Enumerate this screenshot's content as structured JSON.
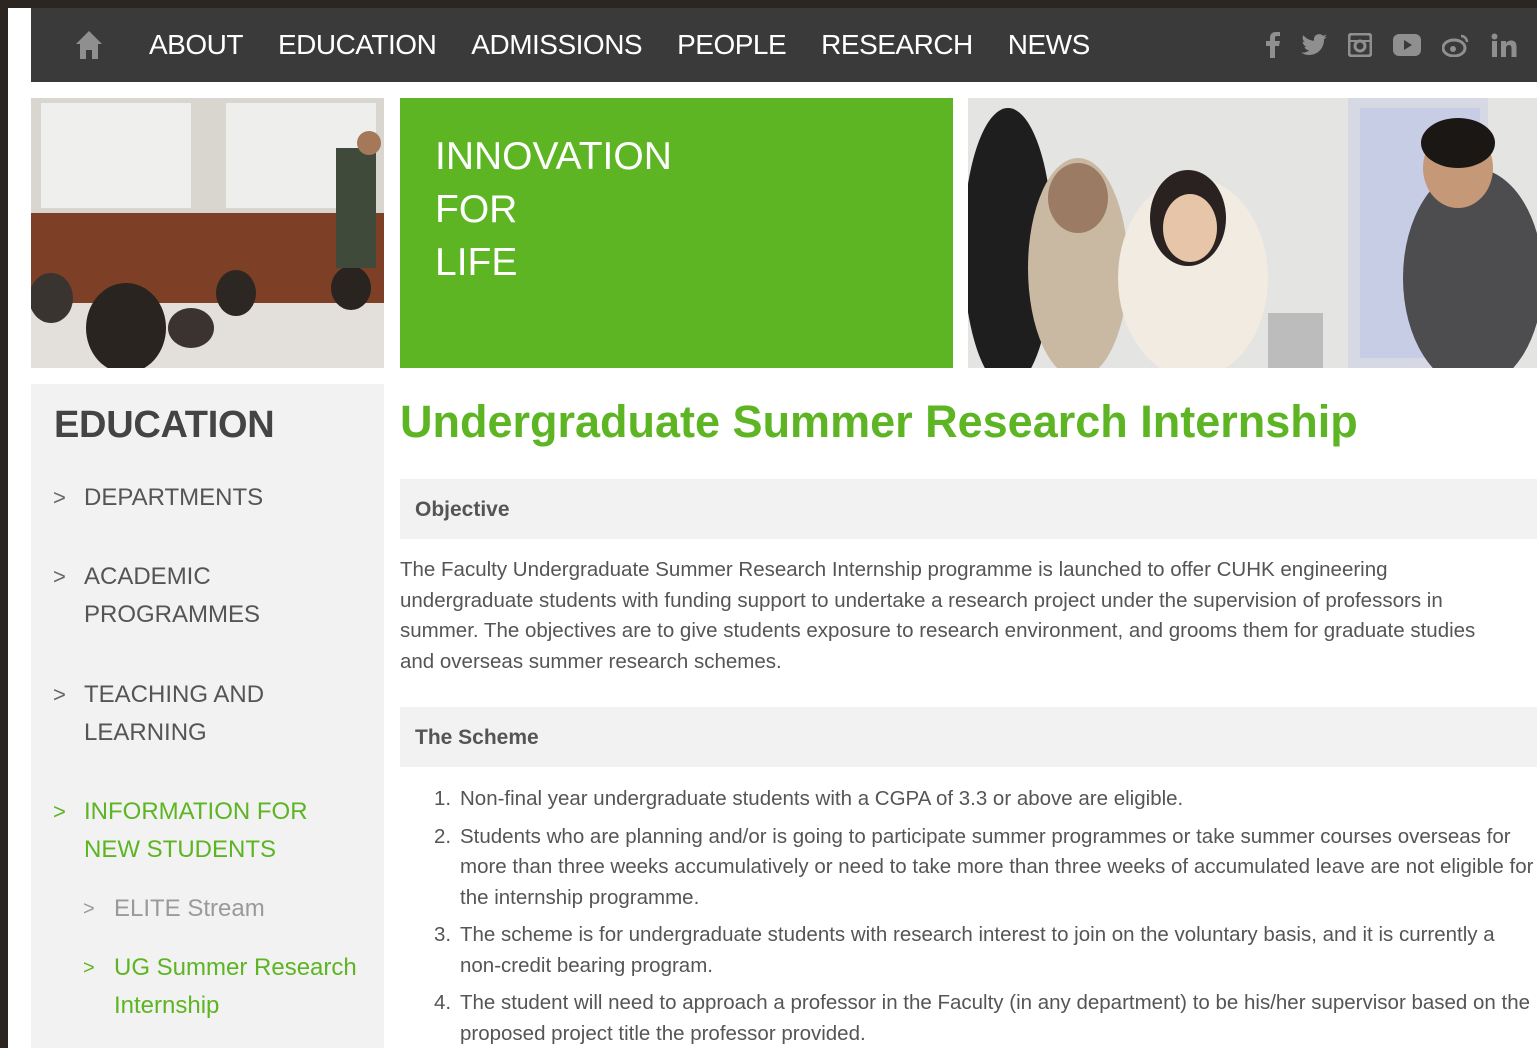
{
  "nav": {
    "home_icon": "home-icon",
    "links": [
      "ABOUT",
      "EDUCATION",
      "ADMISSIONS",
      "PEOPLE",
      "RESEARCH",
      "NEWS"
    ],
    "social_icons": [
      "facebook-icon",
      "twitter-icon",
      "instagram-icon",
      "youtube-icon",
      "weibo-icon",
      "linkedin-icon"
    ],
    "social_glyphs": [
      "f",
      "t",
      "i",
      "y",
      "w",
      "in"
    ]
  },
  "banner": {
    "tagline": [
      "INNOVATION",
      "FOR",
      "LIFE"
    ],
    "accent_color": "#5db523"
  },
  "sidebar": {
    "title": "EDUCATION",
    "items": [
      {
        "label": "DEPARTMENTS"
      },
      {
        "label": "ACADEMIC PROGRAMMES"
      },
      {
        "label": "TEACHING AND LEARNING"
      },
      {
        "label": "INFORMATION FOR NEW STUDENTS"
      }
    ],
    "subitems": [
      {
        "label": "ELITE Stream"
      },
      {
        "label": "UG Summer Research Internship"
      }
    ],
    "chevron": ">"
  },
  "main": {
    "title": "Undergraduate Summer Research Internship",
    "sections": [
      {
        "heading": "Objective",
        "body": "The Faculty Undergraduate Summer Research Internship programme is launched to offer CUHK engineering undergraduate students with funding support to undertake a research project under the supervision of professors in summer. The objectives are to give students exposure to research environment, and grooms them for graduate studies and overseas summer research schemes."
      },
      {
        "heading": "The Scheme",
        "list": [
          "Non-final year undergraduate students with a CGPA of 3.3 or above are eligible.",
          "Students who are planning and/or is going to participate summer programmes or take summer courses overseas for more than three weeks accumulatively or need to take more than three weeks of accumulated leave are not eligible for the internship programme.",
          "The scheme is for undergraduate students with research interest to join on the voluntary basis, and it is currently a non-credit bearing program.",
          "The student will need to approach a professor in the Faculty (in any department) to be his/her supervisor based on the proposed project title the professor provided."
        ],
        "list_numbers": [
          "1.",
          "2.",
          "3.",
          "4."
        ]
      }
    ]
  }
}
